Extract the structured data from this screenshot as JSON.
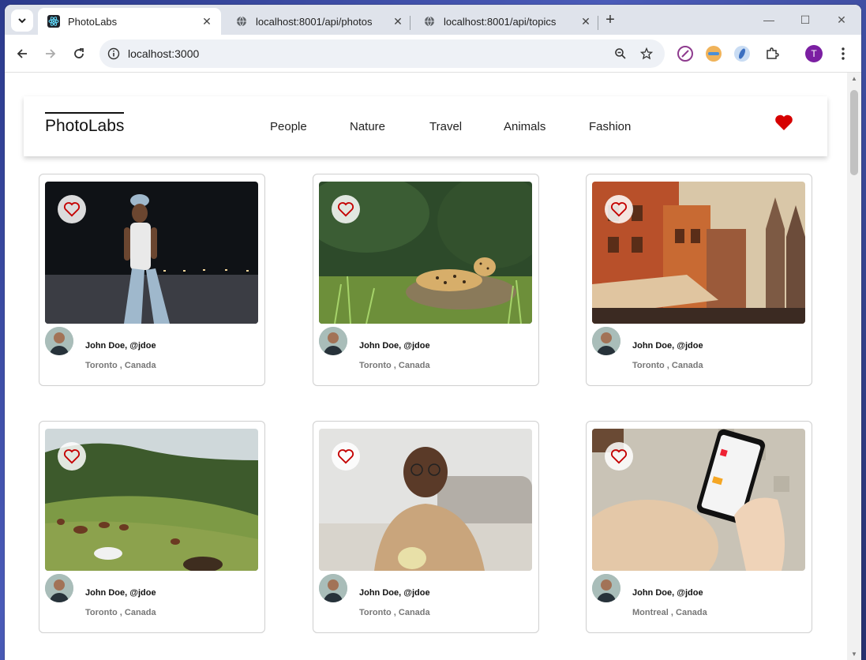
{
  "browser": {
    "tabs": [
      {
        "title": "PhotoLabs",
        "active": true
      },
      {
        "title": "localhost:8001/api/photos",
        "active": false
      },
      {
        "title": "localhost:8001/api/topics",
        "active": false
      }
    ],
    "url": "localhost:3000",
    "profile_initial": "T"
  },
  "app": {
    "logo": "PhotoLabs",
    "topics": [
      "People",
      "Nature",
      "Travel",
      "Animals",
      "Fashion"
    ],
    "heart_color": "#d60000"
  },
  "photos": [
    {
      "name": "John Doe, @jdoe",
      "location": "Toronto , Canada"
    },
    {
      "name": "John Doe, @jdoe",
      "location": "Toronto , Canada"
    },
    {
      "name": "John Doe, @jdoe",
      "location": "Toronto , Canada"
    },
    {
      "name": "John Doe, @jdoe",
      "location": "Toronto , Canada"
    },
    {
      "name": "John Doe, @jdoe",
      "location": "Toronto , Canada"
    },
    {
      "name": "John Doe, @jdoe",
      "location": "Montreal , Canada"
    }
  ]
}
